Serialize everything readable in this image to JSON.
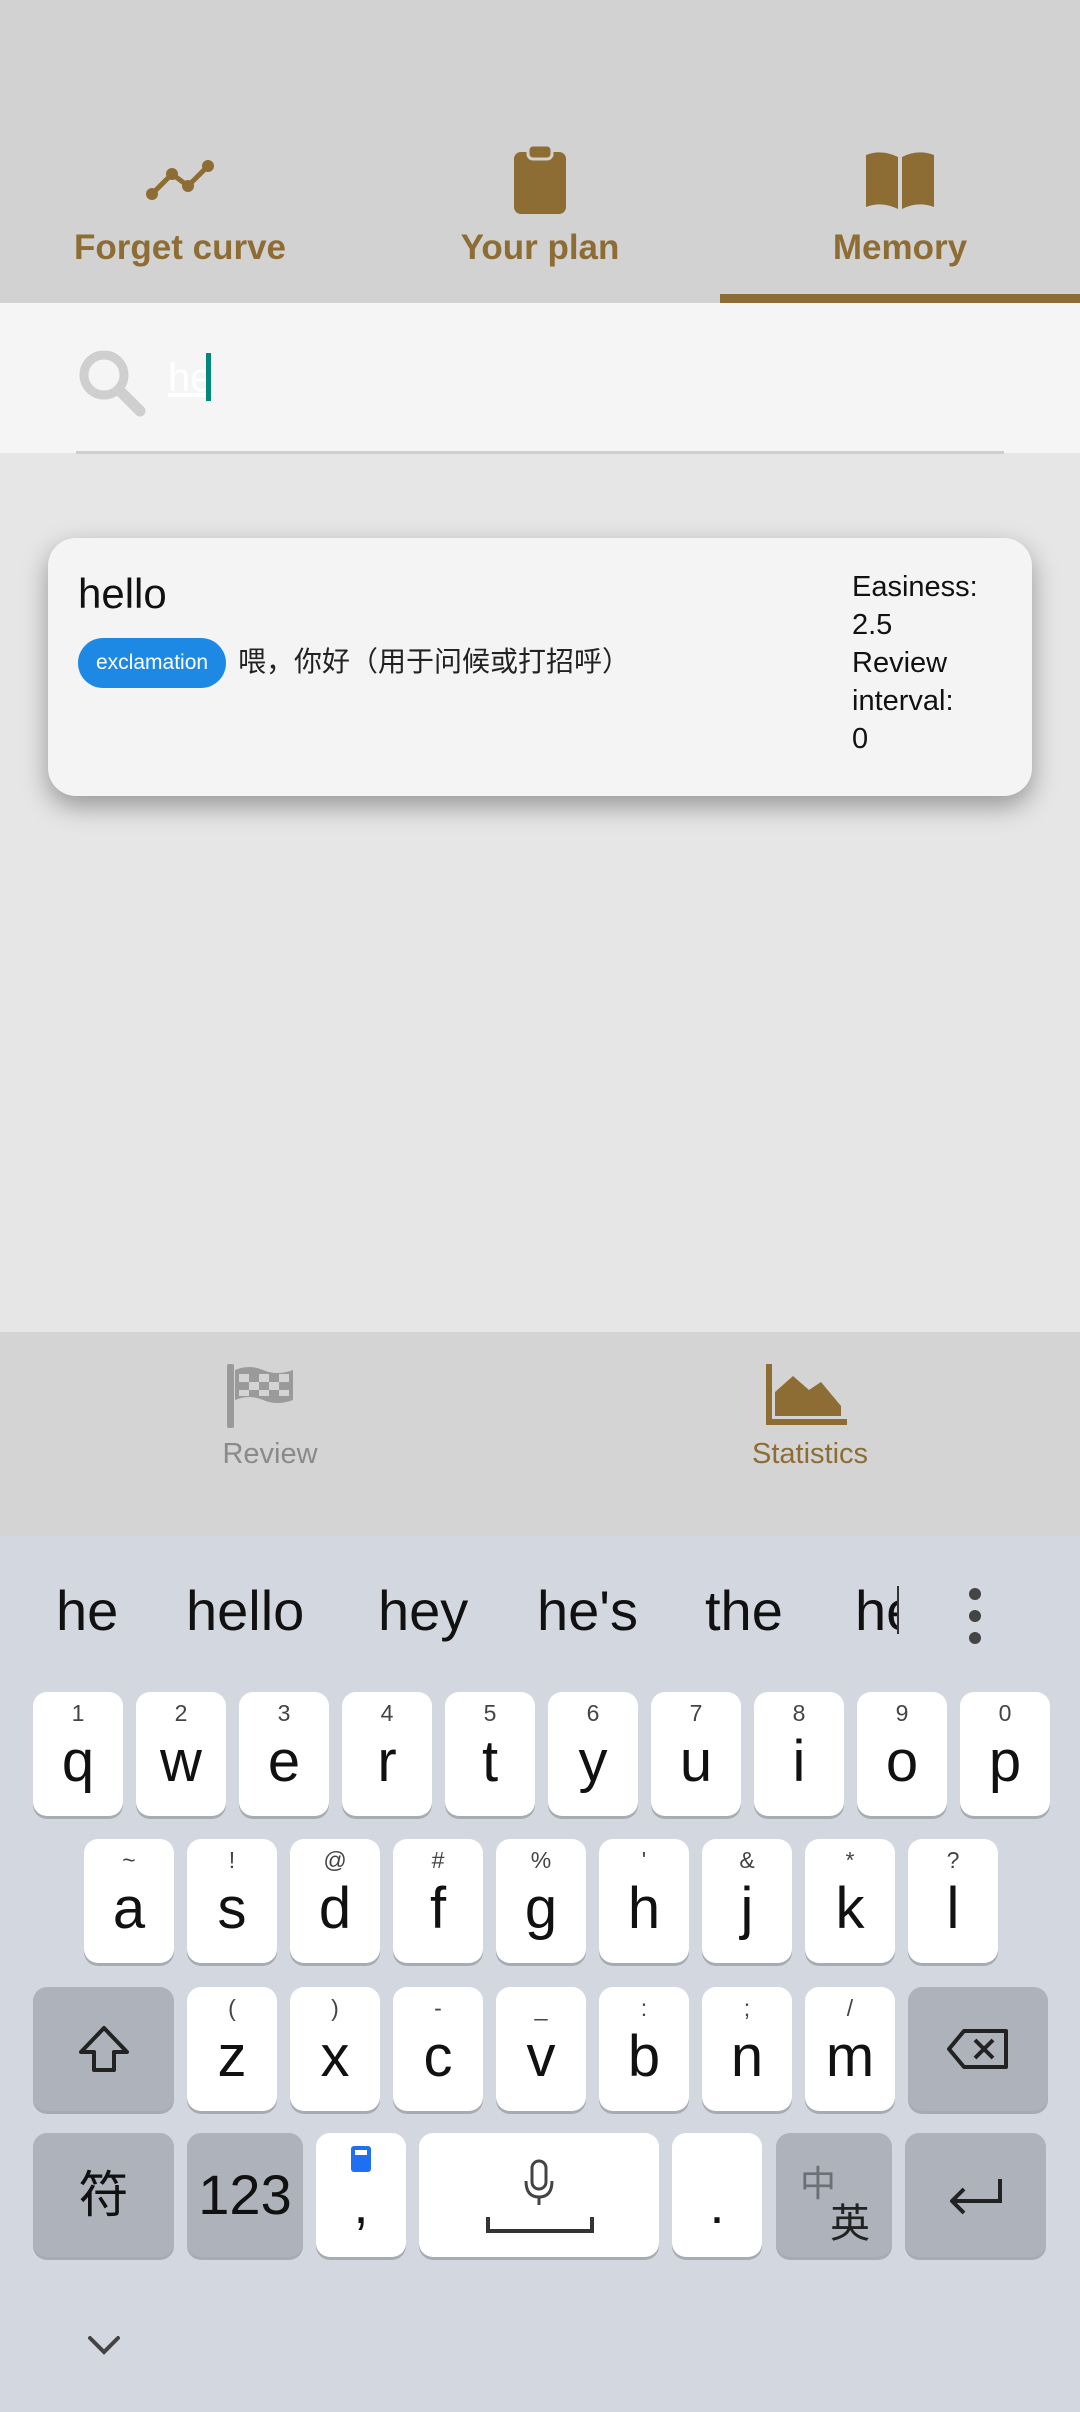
{
  "top_tabs": [
    {
      "label": "Forget curve",
      "icon": "chart-line-icon",
      "active": false
    },
    {
      "label": "Your plan",
      "icon": "clipboard-icon",
      "active": false
    },
    {
      "label": "Memory",
      "icon": "book-open-icon",
      "active": true
    }
  ],
  "search": {
    "value": "he",
    "icon": "search-icon"
  },
  "card": {
    "word": "hello",
    "part_of_speech": "exclamation",
    "meaning": "喂，你好（用于问候或打招呼）",
    "easiness_label": "Easiness:",
    "easiness_value": "2.5",
    "review_label_1": "Review",
    "review_label_2": "interval:",
    "review_value": "0"
  },
  "bottom_nav": [
    {
      "label": "Review",
      "icon": "flag-checkered-icon",
      "active": false
    },
    {
      "label": "Statistics",
      "icon": "chart-area-icon",
      "active": true
    }
  ],
  "keyboard": {
    "suggestions": [
      "he",
      "hello",
      "hey",
      "he's",
      "the",
      "he"
    ],
    "row1": [
      {
        "k": "q",
        "h": "1"
      },
      {
        "k": "w",
        "h": "2"
      },
      {
        "k": "e",
        "h": "3"
      },
      {
        "k": "r",
        "h": "4"
      },
      {
        "k": "t",
        "h": "5"
      },
      {
        "k": "y",
        "h": "6"
      },
      {
        "k": "u",
        "h": "7"
      },
      {
        "k": "i",
        "h": "8"
      },
      {
        "k": "o",
        "h": "9"
      },
      {
        "k": "p",
        "h": "0"
      }
    ],
    "row2": [
      {
        "k": "a",
        "h": "~"
      },
      {
        "k": "s",
        "h": "!"
      },
      {
        "k": "d",
        "h": "@"
      },
      {
        "k": "f",
        "h": "#"
      },
      {
        "k": "g",
        "h": "%"
      },
      {
        "k": "h",
        "h": "'"
      },
      {
        "k": "j",
        "h": "&"
      },
      {
        "k": "k",
        "h": "*"
      },
      {
        "k": "l",
        "h": "?"
      }
    ],
    "row3": [
      {
        "k": "z",
        "h": "("
      },
      {
        "k": "x",
        "h": ")"
      },
      {
        "k": "c",
        "h": "-"
      },
      {
        "k": "v",
        "h": "_"
      },
      {
        "k": "b",
        "h": ":"
      },
      {
        "k": "n",
        "h": ";"
      },
      {
        "k": "m",
        "h": "/"
      }
    ],
    "symbols_label": "符",
    "numbers_label": "123",
    "comma_label": ",",
    "period_label": ".",
    "lang_switch_top": "中",
    "lang_switch_bottom": "英"
  },
  "colors": {
    "accent": "#8e6d34",
    "badge": "#1e88e5",
    "caret": "#00897b",
    "inactive": "#8a8a8a"
  }
}
